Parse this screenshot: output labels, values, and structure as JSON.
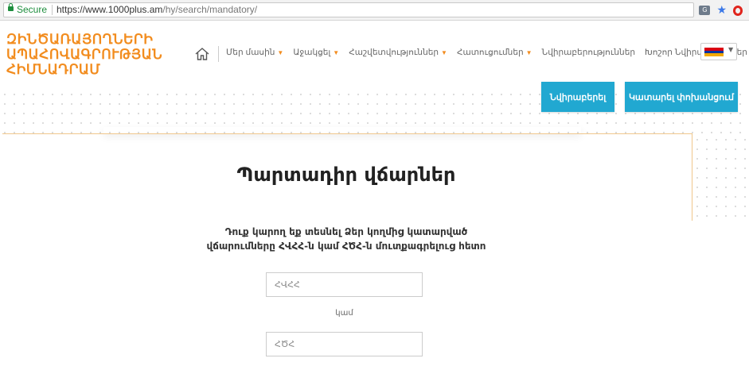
{
  "browser": {
    "secure_label": "Secure",
    "url_base": "https://www.1000plus.am",
    "url_path": "/hy/search/mandatory/"
  },
  "header": {
    "logo_lines": [
      "ԶԻՆԾԱՌԱՅՈՂՆԵՐԻ",
      "ԱՊԱՀՈՎԱԳՐՈՒԹՅԱՆ",
      "ՀԻՄՆԱԴՐԱՄ"
    ],
    "nav": [
      {
        "label": "Մեր մասին",
        "has_caret": true
      },
      {
        "label": "Աջակցել",
        "has_caret": true
      },
      {
        "label": "Հաշվետվություններ",
        "has_caret": true
      },
      {
        "label": "Հատուցումներ",
        "has_caret": true
      },
      {
        "label": "Նվիրաբերություններ",
        "has_caret": false
      },
      {
        "label": "Խոշոր Նվիրաբերողներ",
        "has_caret": true
      }
    ],
    "language_flag": "armenia-flag",
    "accent_color": "#f28c1e"
  },
  "actions": {
    "donate_label": "Նվիրաբերել",
    "pay_label": "Կատարել փոխանցում",
    "button_color": "#21a8d1"
  },
  "main": {
    "title": "Պարտադիր վճարներ",
    "description_line1": "Դուք կարող եք տեսնել Ձեր կողմից կատարված",
    "description_line2": "վճարումները ՀՎՀՀ-ն կամ ՀԾՀ-ն մուտքագրելուց հետո",
    "field1_placeholder": "ՀՎՀՀ",
    "or_label": "կամ",
    "field2_placeholder": "ՀԾՀ"
  }
}
